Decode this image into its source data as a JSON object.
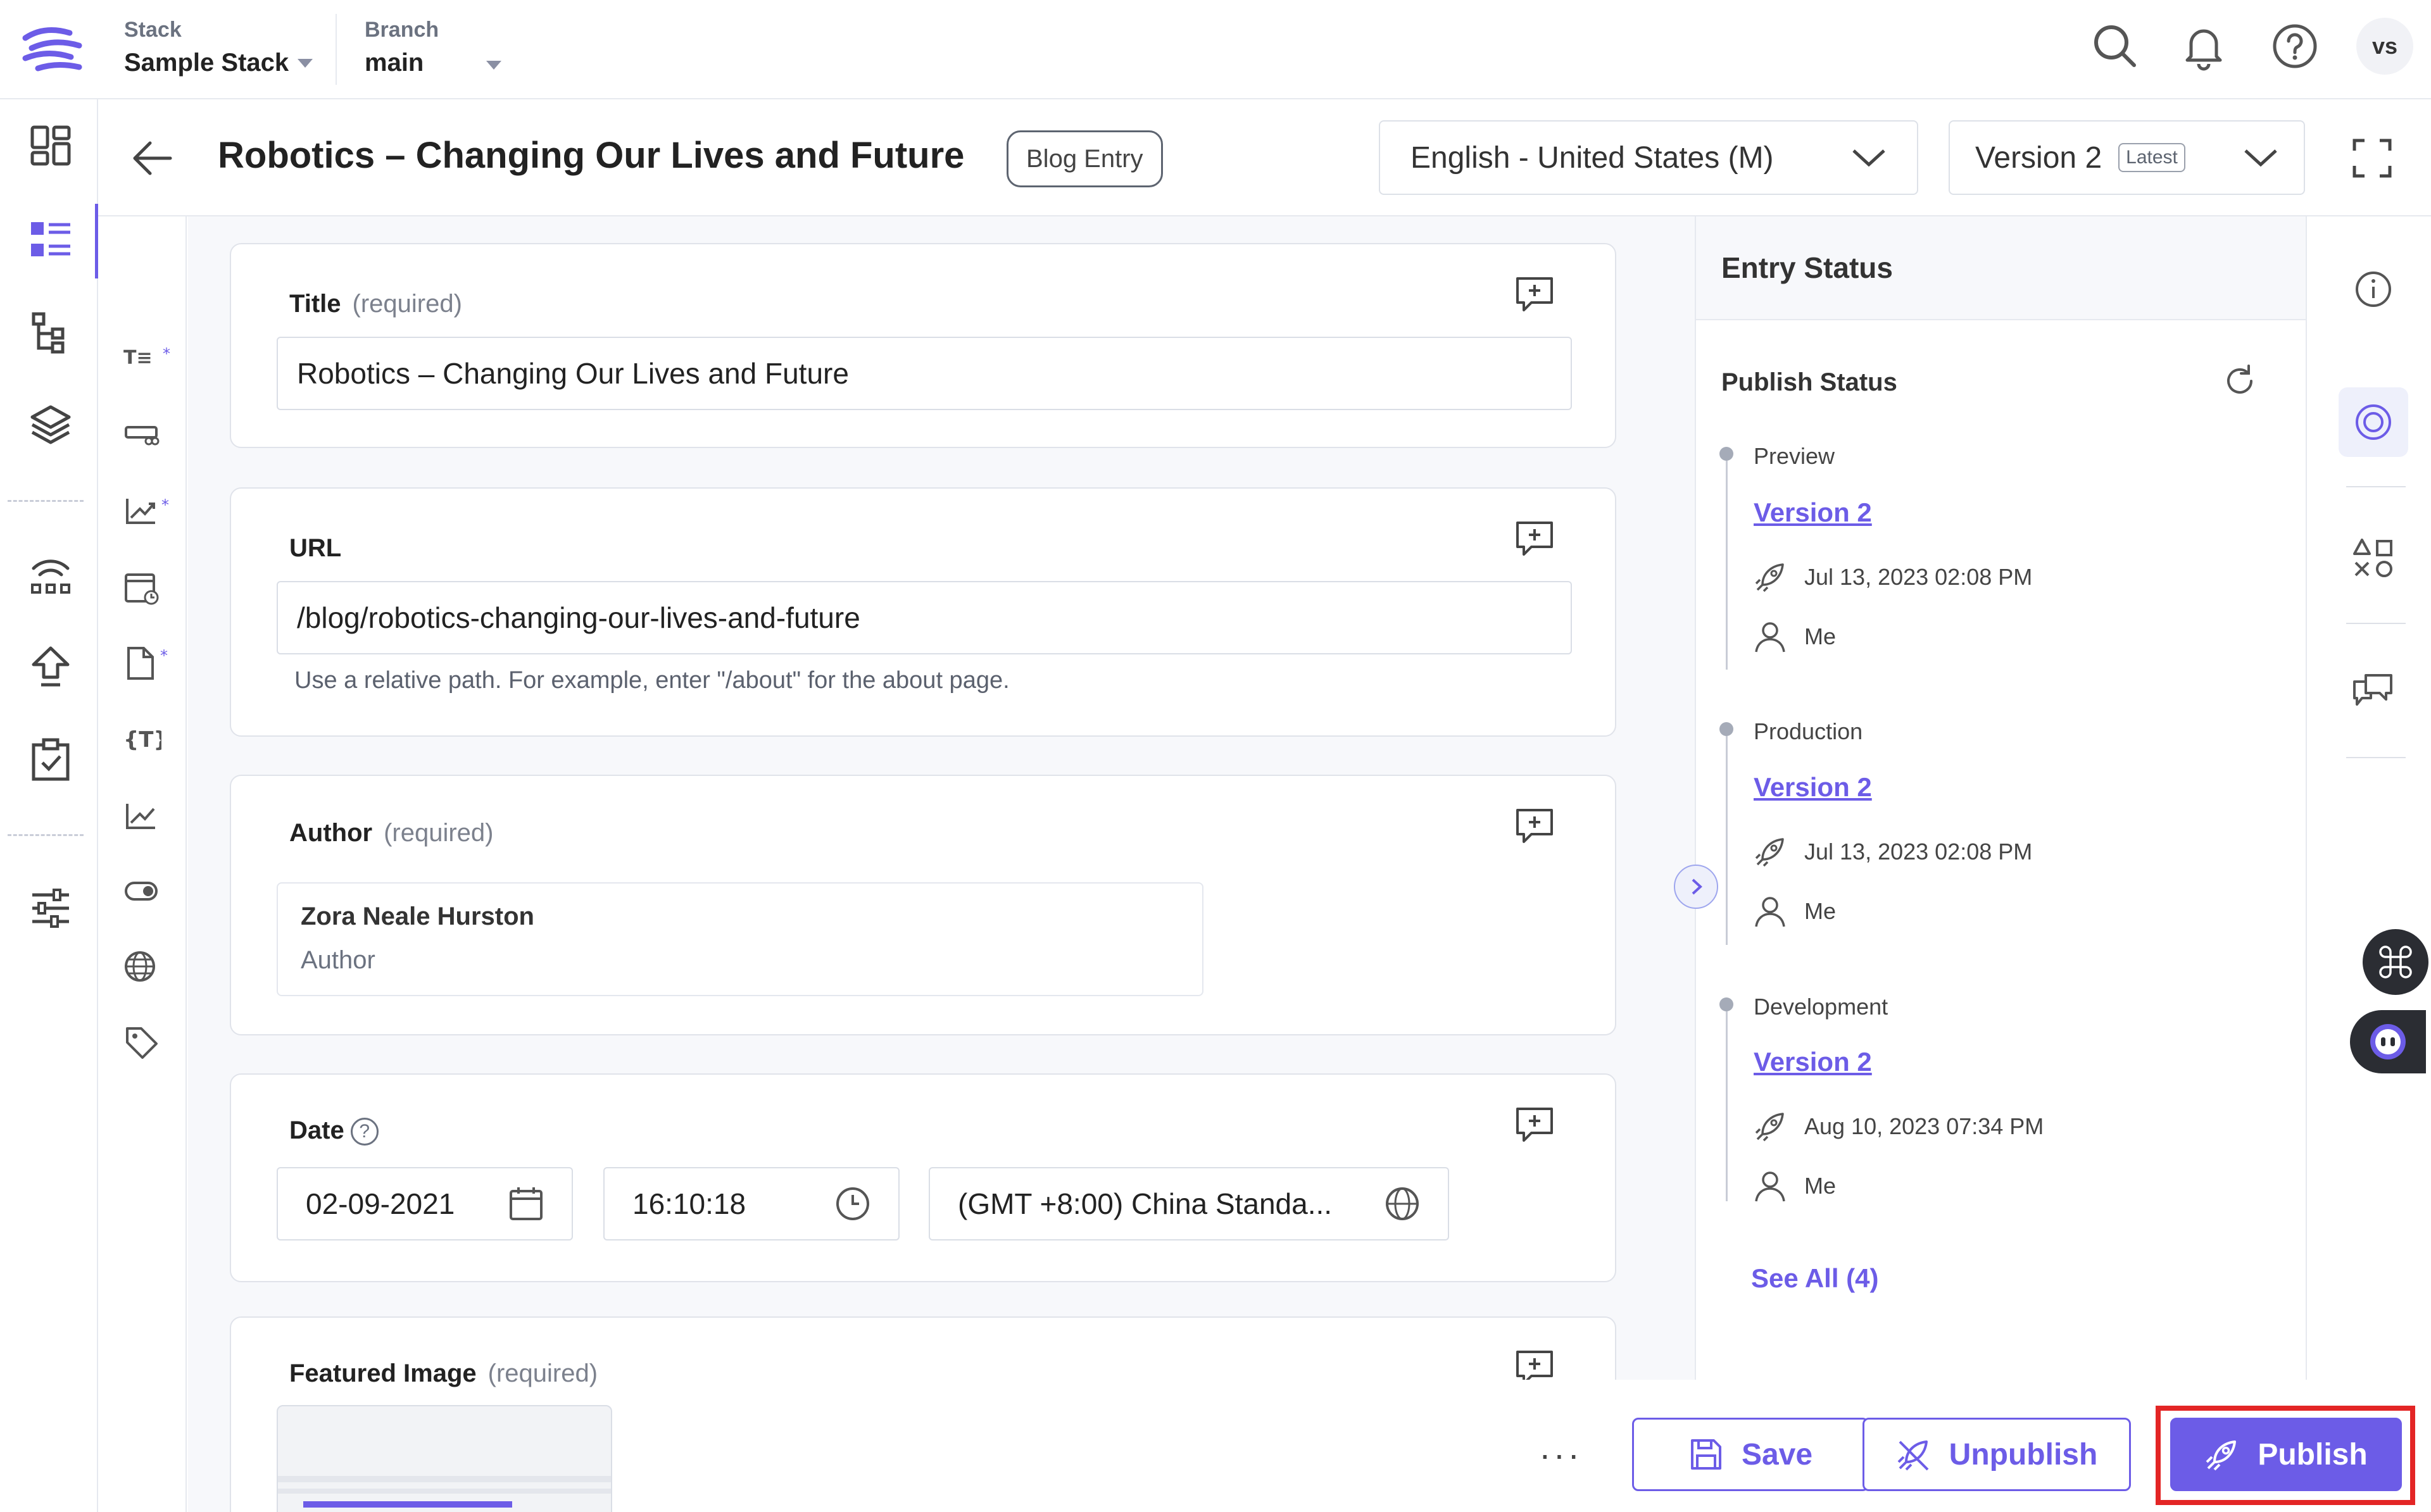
{
  "topbar": {
    "stack_label": "Stack",
    "stack_value": "Sample Stack",
    "branch_label": "Branch",
    "branch_value": "main",
    "avatar_initials": "vs",
    "icons": [
      "search-icon",
      "bell-icon",
      "help-icon"
    ]
  },
  "leftnav": {
    "items": [
      "dashboard-icon",
      "entries-icon",
      "content-models-icon",
      "assets-icon",
      "webhooks-icon",
      "publish-queue-icon",
      "releases-icon",
      "settings-icon"
    ],
    "active": "entries-icon"
  },
  "entry": {
    "title": "Robotics – Changing Our Lives and Future",
    "content_type": "Blog Entry",
    "locale": "English - United States (M)",
    "version": "Version 2",
    "version_badge": "Latest"
  },
  "fields": {
    "title": {
      "label": "Title",
      "required": "(required)",
      "value": "Robotics – Changing Our Lives and Future"
    },
    "url": {
      "label": "URL",
      "value": "/blog/robotics-changing-our-lives-and-future",
      "help": "Use a relative path. For example, enter \"/about\" for the about page."
    },
    "author": {
      "label": "Author",
      "required": "(required)",
      "ref_name": "Zora Neale Hurston",
      "ref_type": "Author"
    },
    "date": {
      "label": "Date",
      "help_glyph": "?",
      "date": "02-09-2021",
      "time": "16:10:18",
      "timezone": "(GMT +8:00) China Standa..."
    },
    "featured_image": {
      "label": "Featured Image",
      "required": "(required)"
    }
  },
  "status_panel": {
    "header": "Entry Status",
    "publish_status": "Publish Status",
    "environments": [
      {
        "name": "Preview",
        "version": "Version 2",
        "date": "Jul 13, 2023 02:08 PM",
        "user": "Me"
      },
      {
        "name": "Production",
        "version": "Version 2",
        "date": "Jul 13, 2023 02:08 PM",
        "user": "Me"
      },
      {
        "name": "Development",
        "version": "Version 2",
        "date": "Aug 10, 2023 07:34 PM",
        "user": "Me"
      }
    ],
    "see_all": "See All (4)"
  },
  "actions": {
    "more": "···",
    "save": "Save",
    "unpublish": "Unpublish",
    "publish": "Publish"
  },
  "colors": {
    "accent": "#6c5ce7",
    "highlight": "#e32525",
    "border": "#e6e9ef"
  }
}
